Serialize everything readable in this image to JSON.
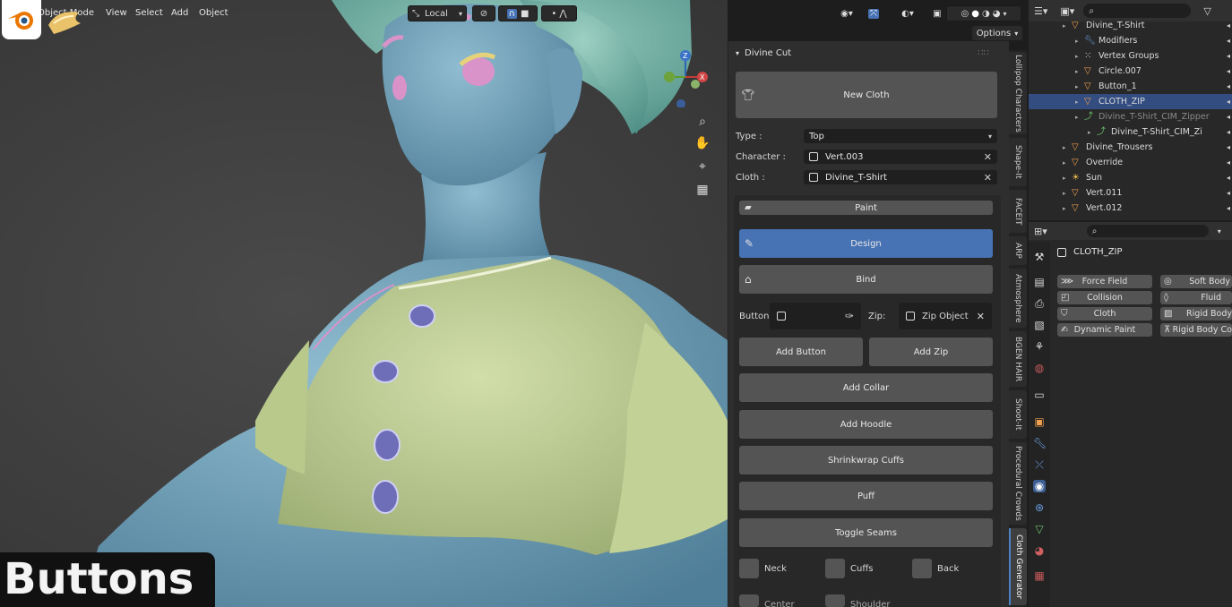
{
  "viewport_header": {
    "mode_label": "Object Mode",
    "menus": [
      "View",
      "Select",
      "Add",
      "Object"
    ],
    "transform_orientation": "Local",
    "options_label": "Options"
  },
  "caption": "Buttons",
  "panel": {
    "title": "Divine Cut",
    "new_cloth_label": "New Cloth",
    "type_label": "Type :",
    "type_value": "Top",
    "character_label": "Character :",
    "character_value": "Vert.003",
    "cloth_label": "Cloth :",
    "cloth_value": "Divine_T-Shirt",
    "paint_label": "Paint",
    "design_label": "Design",
    "bind_label": "Bind",
    "button_label": "Button:",
    "zip_label": "Zip:",
    "zip_value": "Zip Object",
    "add_button_label": "Add Button",
    "add_zip_label": "Add Zip",
    "add_collar_label": "Add Collar",
    "add_hoodie_label": "Add Hoodle",
    "shrinkwrap_label": "Shrinkwrap Cuffs",
    "puff_label": "Puff",
    "toggle_seams_label": "Toggle Seams",
    "checkboxes": [
      "Neck",
      "Cuffs",
      "Back",
      "Center",
      "Shoulder"
    ]
  },
  "vertical_tabs": [
    "Lollipop Characters",
    "Shape-It",
    "FACEIT",
    "ARP",
    "Atmosphere",
    "BGEN HAIR",
    "Shoot-It",
    "Procedural Crowds",
    "Cloth Generator"
  ],
  "outliner": {
    "rows": [
      {
        "label": "Divine_T-Shirt",
        "indent": 0,
        "icon": "mesh"
      },
      {
        "label": "Modifiers",
        "indent": 1,
        "icon": "wrench"
      },
      {
        "label": "Vertex Groups",
        "indent": 1,
        "icon": "vgroup"
      },
      {
        "label": "Circle.007",
        "indent": 1,
        "icon": "mesh"
      },
      {
        "label": "Button_1",
        "indent": 1,
        "icon": "mesh"
      },
      {
        "label": "CLOTH_ZIP",
        "indent": 1,
        "icon": "mesh",
        "selected": true
      },
      {
        "label": "Divine_T-Shirt_CIM_Zipper",
        "indent": 1,
        "icon": "curve",
        "dim": true
      },
      {
        "label": "Divine_T-Shirt_CIM_Zi",
        "indent": 2,
        "icon": "curve"
      },
      {
        "label": "Divine_Trousers",
        "indent": 0,
        "icon": "mesh"
      },
      {
        "label": "Override",
        "indent": 0,
        "icon": "mesh"
      },
      {
        "label": "Sun",
        "indent": 0,
        "icon": "light"
      },
      {
        "label": "Vert.011",
        "indent": 0,
        "icon": "mesh"
      },
      {
        "label": "Vert.012",
        "indent": 0,
        "icon": "mesh"
      }
    ]
  },
  "properties": {
    "object_name": "CLOTH_ZIP",
    "physics_buttons_left": [
      "Force Field",
      "Collision",
      "Cloth",
      "Dynamic Paint"
    ],
    "physics_buttons_right": [
      "Soft Body",
      "Fluid",
      "Rigid Body",
      "Rigid Body Co"
    ]
  },
  "colors": {
    "accent_blue": "#4772b3",
    "selection": "#334d80",
    "shirt": "#b9c98a",
    "skin": "#6f9cb5",
    "button_purple": "#7c7cc9"
  }
}
